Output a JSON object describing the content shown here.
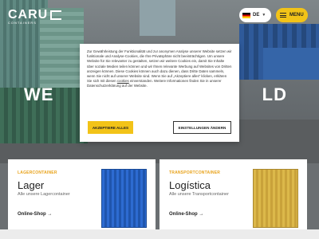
{
  "header": {
    "logo_text": "CARU",
    "logo_sub": "CONTAINERS",
    "language": "DE",
    "menu_label": "MENU"
  },
  "hero": {
    "title_left": "WE",
    "title_right": "LD"
  },
  "cookie_dialog": {
    "text_1": "Zur Gewährleistung der Funktionalität und zur anonymen Analyse unserer Website setzen wir funktionale und Analyse-Cookies, die Ihre Privatsphäre nicht beeinträchtigen. Um unsere Website für Sie relevanter zu gestalten, setzen wir weitere Cookies ein, damit Sie Inhalte über soziale Medien teilen können und wir Ihnen relevante Werbung auf Websites von Dritten anzeigen können. Diese Cookies können auch dazu dienen, dass Dritte Daten sammeln, wenn Sie nicht auf unserer Website sind. Wenn Sie auf „Akzeptiere alles\" klicken, erklären Sie sich mit diesen",
    "link_text": "cookies",
    "text_2": "einverstanden. Weitere Informationen finden Sie in unserer Datenschutzerklärung auf der Website.",
    "accept_label": "AKZEPTIERE ALLES",
    "settings_label": "EINSTELLUNGEN ÄNDERN"
  },
  "cards": [
    {
      "kicker": "LAGERCONTAINER",
      "title": "Lager",
      "subtitle": "Alle unsere Lagercontainer",
      "link": "Online-Shop →"
    },
    {
      "kicker": "TRANSPORTCONTAINER",
      "title": "Logística",
      "subtitle": "Alle unsere Transportcontainer",
      "link": "Online-Shop →"
    }
  ],
  "colors": {
    "accent": "#f2c318",
    "kicker": "#e8a21a"
  }
}
